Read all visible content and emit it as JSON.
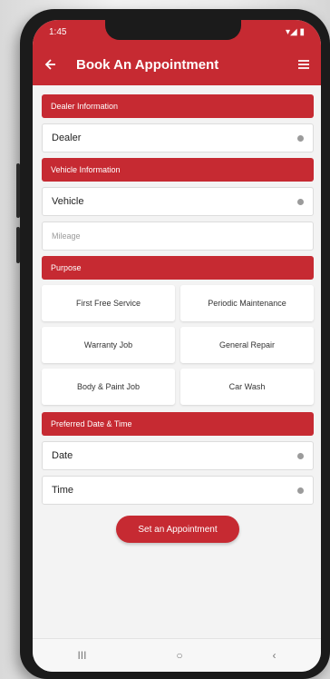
{
  "statusbar": {
    "time": "1:45",
    "right": "▾◢ ▮"
  },
  "appbar": {
    "title": "Book An Appointment"
  },
  "dealer_section": {
    "header": "Dealer Information",
    "field": "Dealer"
  },
  "vehicle_section": {
    "header": "Vehicle Information",
    "field": "Vehicle",
    "mileage_placeholder": "Mileage"
  },
  "purpose_section": {
    "header": "Purpose",
    "options": [
      "First Free Service",
      "Periodic Maintenance",
      "Warranty Job",
      "General Repair",
      "Body & Paint Job",
      "Car Wash"
    ]
  },
  "datetime_section": {
    "header": "Preferred Date & Time",
    "date": "Date",
    "time": "Time"
  },
  "submit": {
    "label": "Set an Appointment"
  },
  "navbar": {
    "recent": "III",
    "home": "○",
    "back": "‹"
  },
  "colors": {
    "accent": "#c62a32",
    "background": "#f3f3f3"
  }
}
